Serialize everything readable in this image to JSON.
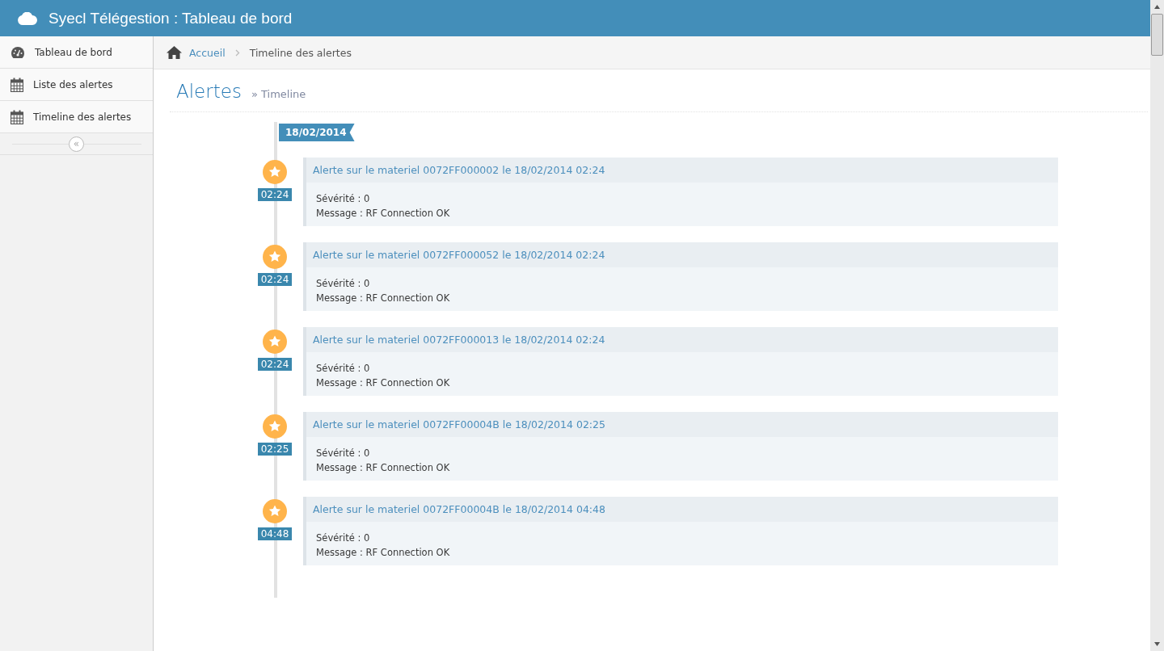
{
  "header": {
    "title": "Syecl Télégestion : Tableau de bord"
  },
  "sidebar": {
    "items": [
      {
        "label": "Tableau de bord",
        "kind": "dashboard"
      },
      {
        "label": "Liste des alertes",
        "kind": "calendar"
      },
      {
        "label": "Timeline des alertes",
        "kind": "calendar"
      }
    ],
    "collapse": "«"
  },
  "breadcrumb": [
    {
      "label": "Accueil",
      "link": true
    },
    {
      "label": "Timeline des alertes",
      "link": false
    }
  ],
  "page": {
    "title": "Alertes",
    "subtitle": "» Timeline"
  },
  "timeline": {
    "date": "18/02/2014",
    "items": [
      {
        "time": "02:24",
        "title": "Alerte sur le materiel 0072FF000002 le 18/02/2014 02:24",
        "severity": "Sévérité : 0",
        "message": "Message : RF Connection OK"
      },
      {
        "time": "02:24",
        "title": "Alerte sur le materiel 0072FF000052 le 18/02/2014 02:24",
        "severity": "Sévérité : 0",
        "message": "Message : RF Connection OK"
      },
      {
        "time": "02:24",
        "title": "Alerte sur le materiel 0072FF000013 le 18/02/2014 02:24",
        "severity": "Sévérité : 0",
        "message": "Message : RF Connection OK"
      },
      {
        "time": "02:25",
        "title": "Alerte sur le materiel 0072FF00004B le 18/02/2014 02:25",
        "severity": "Sévérité : 0",
        "message": "Message : RF Connection OK"
      },
      {
        "time": "04:48",
        "title": "Alerte sur le materiel 0072FF00004B le 18/02/2014 04:48",
        "severity": "Sévérité : 0",
        "message": "Message : RF Connection OK"
      }
    ]
  }
}
